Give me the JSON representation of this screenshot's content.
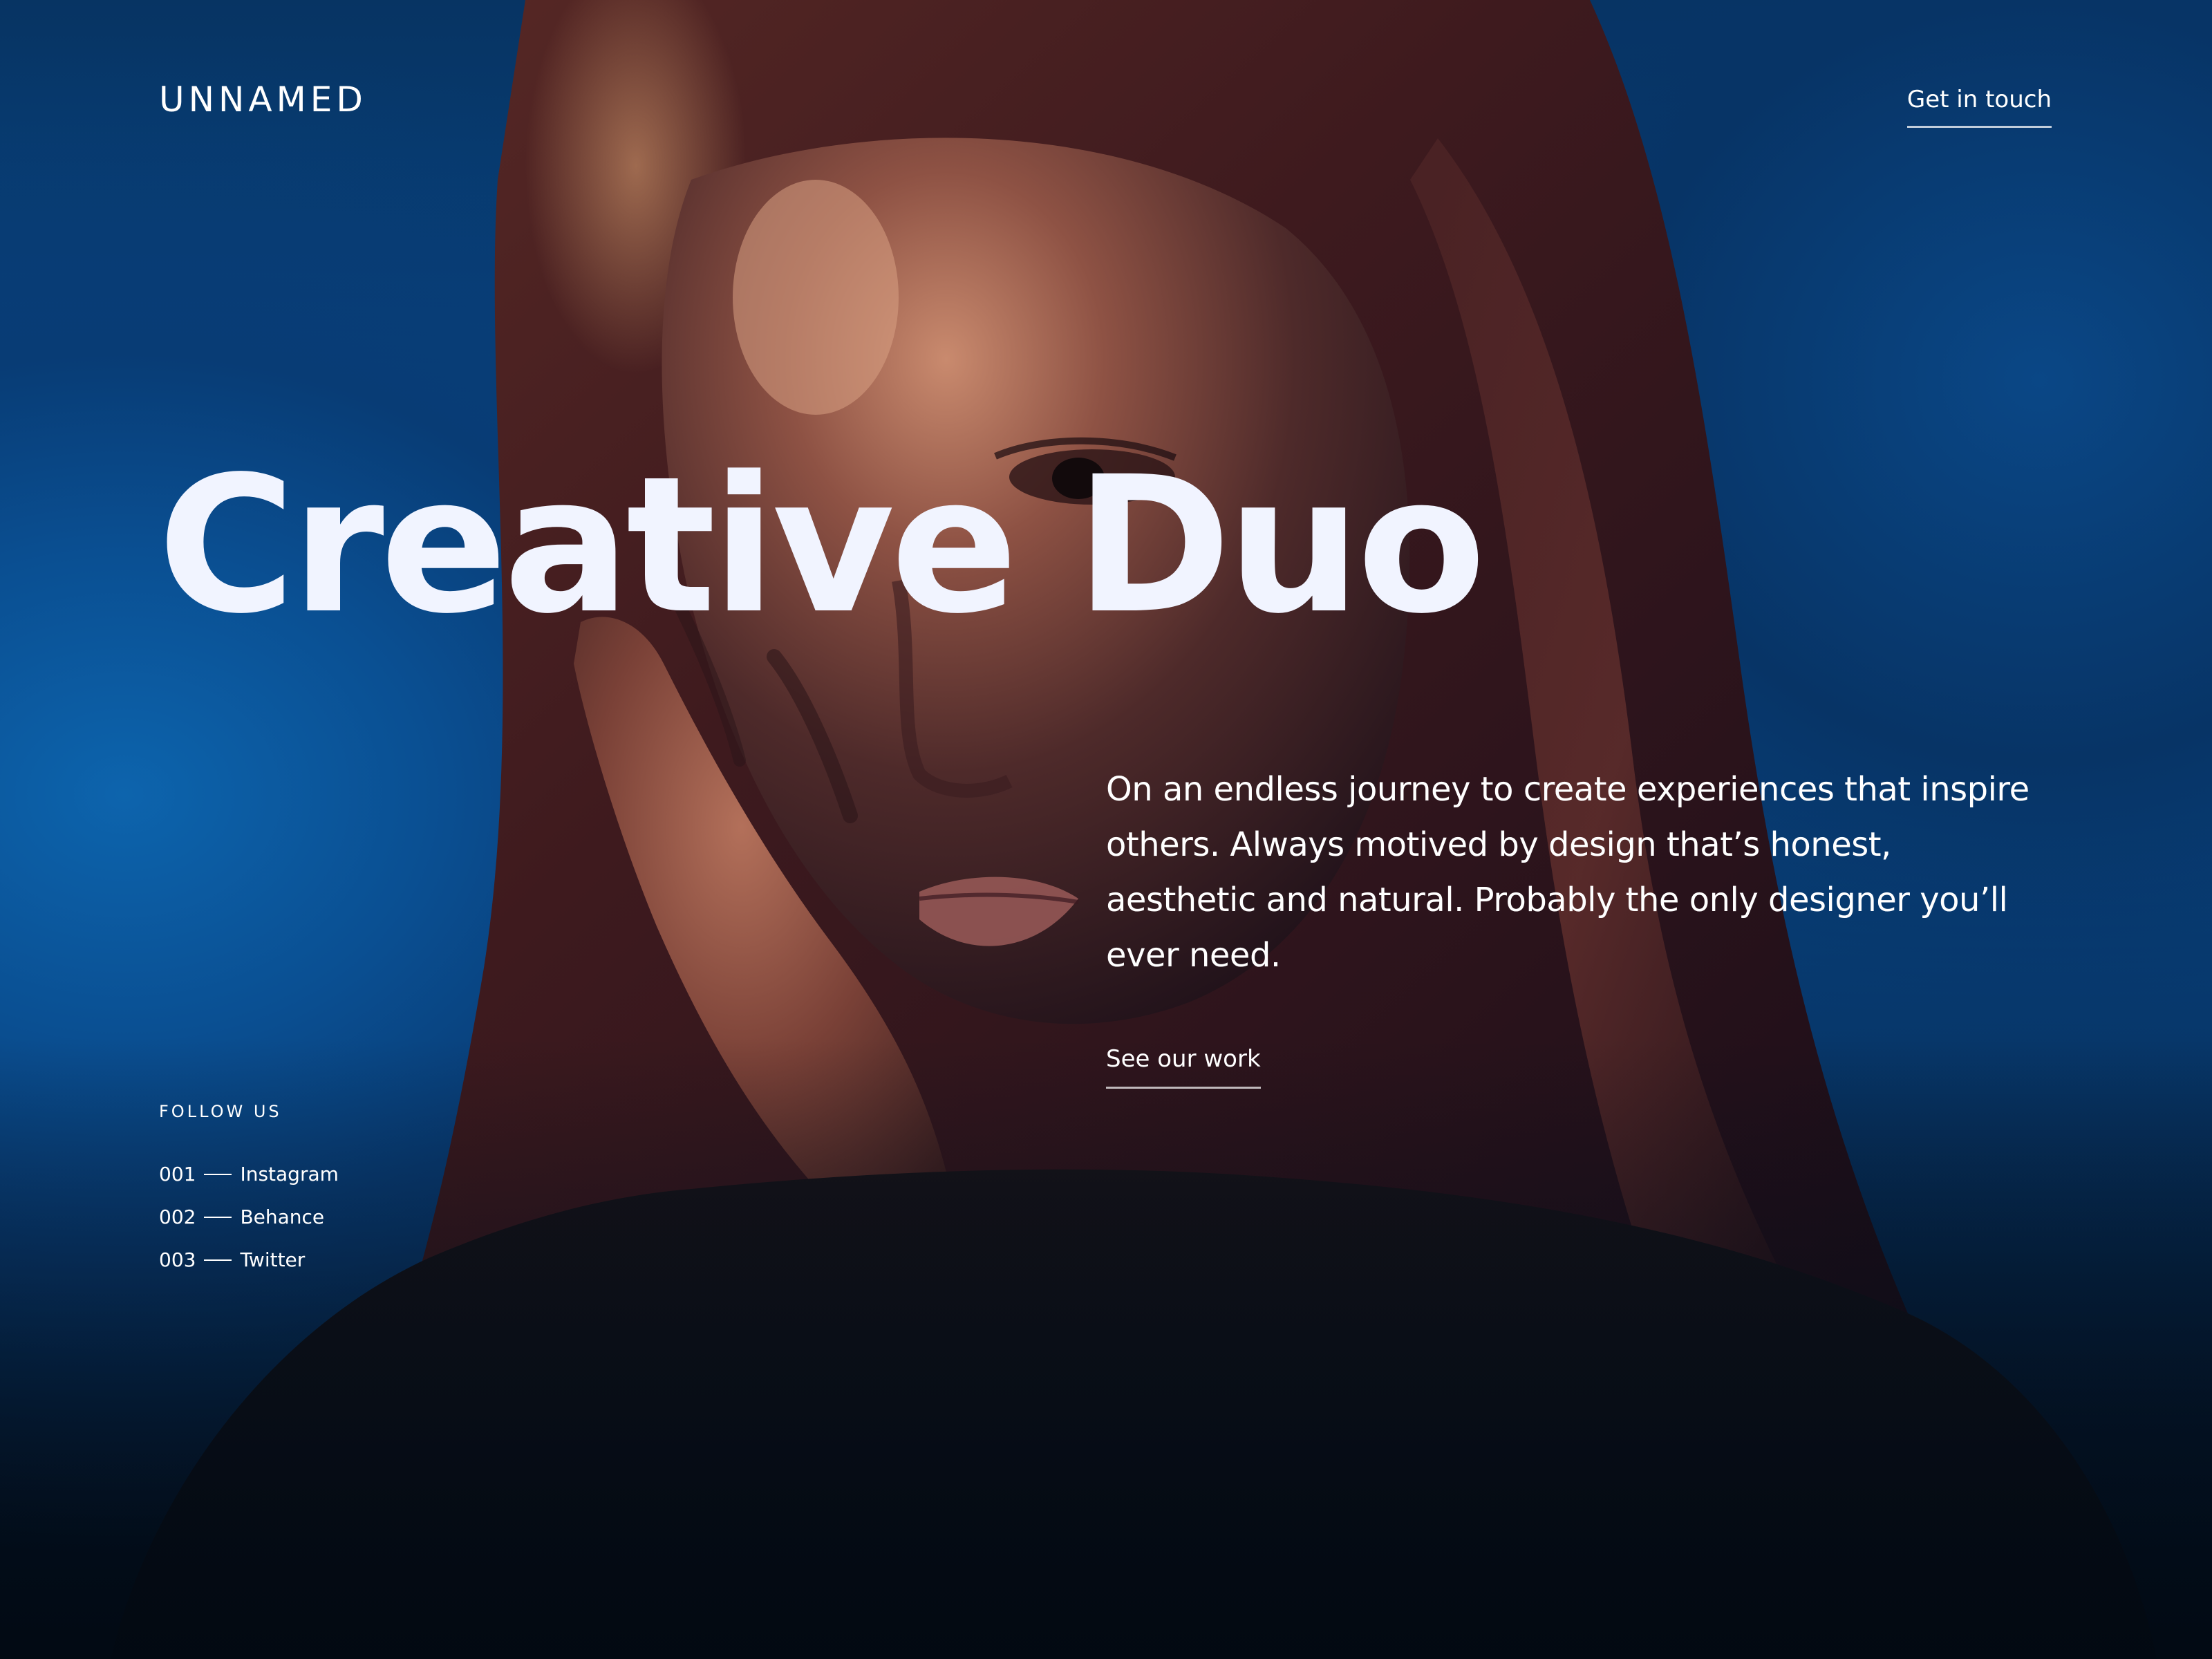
{
  "header": {
    "logo": "UNNAMED",
    "contact_link": "Get in touch"
  },
  "hero": {
    "title": "Creative Duo",
    "description": "On an endless journey to create experiences that inspire others. Always motived by design that’s honest, aesthetic and natural. Probably the only designer you’ll ever need.",
    "cta": "See our work"
  },
  "social": {
    "title": "FOLLOW US",
    "items": [
      {
        "number": "001",
        "label": "Instagram"
      },
      {
        "number": "002",
        "label": "Behance"
      },
      {
        "number": "003",
        "label": "Twitter"
      }
    ]
  },
  "colors": {
    "background_blue": "#0a5aa3",
    "deep_navy": "#041a33",
    "text": "#ffffff",
    "title": "#f1f4ff"
  }
}
